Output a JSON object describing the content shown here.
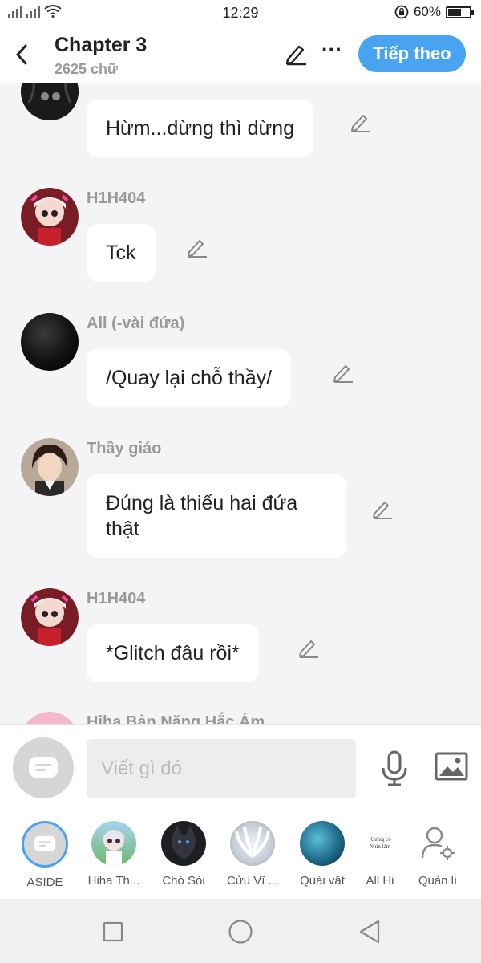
{
  "status": {
    "time": "12:29",
    "battery": "60%",
    "battery_level": 0.6
  },
  "header": {
    "title": "Chapter 3",
    "subtitle": "2625 chữ",
    "next_label": "Tiếp theo",
    "more_label": "···"
  },
  "messages": [
    {
      "sender": "",
      "text": "Hừm...dừng thì dừng"
    },
    {
      "sender": "H1H404",
      "text": "Tck"
    },
    {
      "sender": "All (-vài đứa)",
      "text": "/Quay lại chỗ thầy/"
    },
    {
      "sender": "Thầy giáo",
      "text": "Đúng là thiếu hai đứa thật"
    },
    {
      "sender": "H1H404",
      "text": "*Glitch đâu rồi*"
    },
    {
      "sender": "Hiha Bản Năng Hắc Ám",
      "text": ""
    }
  ],
  "composer": {
    "placeholder": "Viết gì đó"
  },
  "characters": [
    {
      "label": "ASIDE"
    },
    {
      "label": "Hiha Th..."
    },
    {
      "label": "Chó Sói"
    },
    {
      "label": "Cửu Vĩ ..."
    },
    {
      "label": "Quái vật"
    },
    {
      "label": "All Hi",
      "avatar_text": "Không có Nhìn làm"
    },
    {
      "label": "Quản lí"
    }
  ],
  "colors": {
    "accent": "#4aa3f0",
    "background": "#f4f4f6"
  }
}
